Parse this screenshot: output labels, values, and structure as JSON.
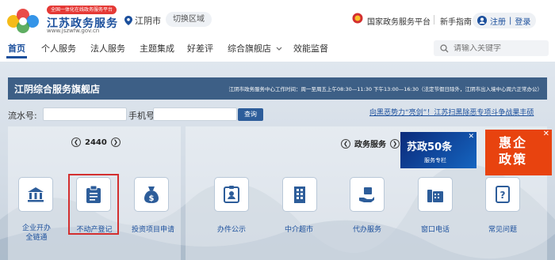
{
  "header": {
    "badge": "全国一体化在线政务服务平台",
    "title": "江苏政务服务",
    "url": "www.jszwfw.gov.cn",
    "location": "江阴市",
    "switch_label": "切换区域",
    "gov_platform": "国家政务服务平台",
    "guide": "新手指南",
    "register": "注册",
    "divider": "|",
    "login": "登录"
  },
  "nav": {
    "items": [
      "首页",
      "个人服务",
      "法人服务",
      "主题集成",
      "好差评",
      "综合旗舰店",
      "效能监督"
    ],
    "search_placeholder": "请输入关键字"
  },
  "banner": {
    "title": "江阴综合服务旗舰店",
    "hours": "江阴市政务服务中心工作时间：周一至周五上午08:30—11:30 下午13:00—16:30（法定节假日除外，江阴市出入境中心周六正常办公）"
  },
  "query": {
    "flow_label": "流水号:",
    "phone_label": "手机号",
    "button": "查询",
    "notice": "向黑恶势力“亮剑”！江苏扫黑除恶专项斗争战果丰硕"
  },
  "left_panel": {
    "count": "2440",
    "tiles": [
      "企业开办\n全链通",
      "不动产登记",
      "投资项目申请"
    ]
  },
  "right_panel": {
    "heading": "政务服务",
    "tiles": [
      "办件公示",
      "中介超市",
      "代办服务",
      "窗口电话",
      "常见问题"
    ]
  },
  "promos": {
    "suzheng": "苏政50条",
    "suzheng_sub": "服务专栏",
    "huiqi": "惠企\n政策"
  },
  "colors": {
    "brand": "#1b4f9c",
    "banner": "#3d5f86",
    "promo_orange": "#e8430f",
    "highlight": "#d32f2f"
  }
}
